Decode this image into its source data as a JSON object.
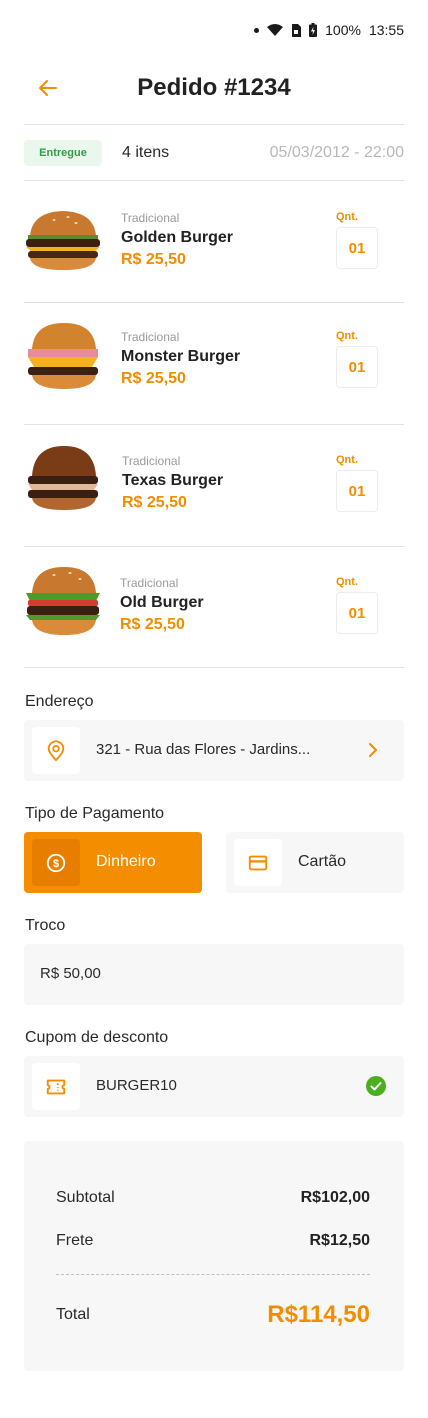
{
  "status_bar": {
    "battery": "100%",
    "time": "13:55"
  },
  "header": {
    "title": "Pedido #1234"
  },
  "order_meta": {
    "status": "Entregue",
    "items_count": "4 itens",
    "date": "05/03/2012 - 22:00"
  },
  "items": [
    {
      "category": "Tradicional",
      "name": "Golden Burger",
      "price": "R$ 25,50",
      "qty_label": "Qnt.",
      "qty": "01"
    },
    {
      "category": "Tradicional",
      "name": "Monster Burger",
      "price": "R$ 25,50",
      "qty_label": "Qnt.",
      "qty": "01"
    },
    {
      "category": "Tradicional",
      "name": "Texas Burger",
      "price": "R$ 25,50",
      "qty_label": "Qnt.",
      "qty": "01"
    },
    {
      "category": "Tradicional",
      "name": "Old Burger",
      "price": "R$ 25,50",
      "qty_label": "Qnt.",
      "qty": "01"
    }
  ],
  "address": {
    "label": "Endereço",
    "value": "321 - Rua das Flores - Jardins..."
  },
  "payment": {
    "label": "Tipo de Pagamento",
    "cash": "Dinheiro",
    "card": "Cartão",
    "selected": "cash"
  },
  "change": {
    "label": "Troco",
    "value": "R$ 50,00"
  },
  "coupon": {
    "label": "Cupom de desconto",
    "value": "BURGER10"
  },
  "summary": {
    "subtotal_label": "Subtotal",
    "subtotal": "R$102,00",
    "shipping_label": "Frete",
    "shipping": "R$12,50",
    "total_label": "Total",
    "total": "R$114,50"
  },
  "colors": {
    "accent": "#f58d00",
    "success": "#2e9e46",
    "check": "#4caf1f"
  }
}
